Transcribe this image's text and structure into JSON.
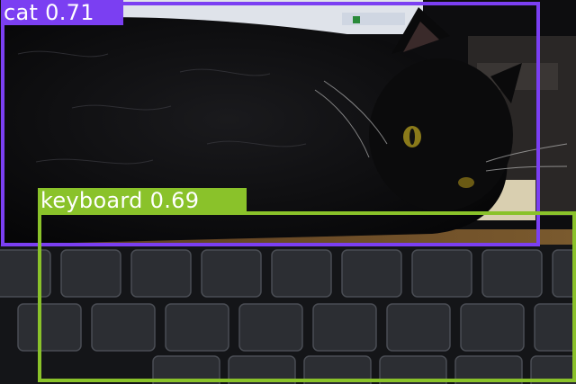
{
  "detections": [
    {
      "label": "cat",
      "score": "0.71",
      "color": "#7B3FF2"
    },
    {
      "label": "keyboard",
      "score": "0.69",
      "color": "#8AC22A"
    }
  ]
}
